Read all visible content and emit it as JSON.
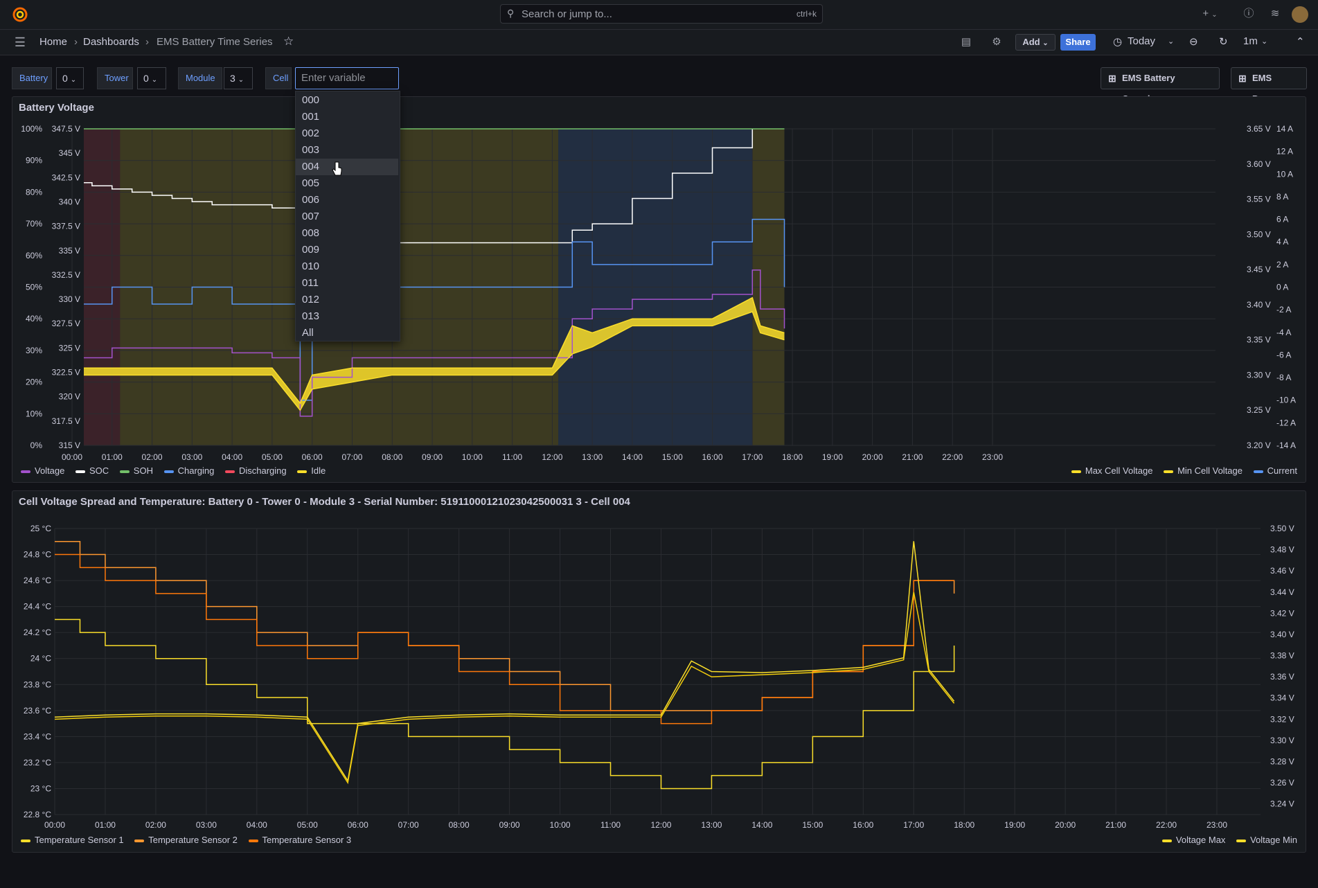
{
  "topbar": {
    "search_placeholder": "Search or jump to...",
    "search_shortcut": "ctrl+k",
    "plus_label": "+"
  },
  "breadcrumb": {
    "home": "Home",
    "dashboards": "Dashboards",
    "current": "EMS Battery Time Series"
  },
  "toolbar": {
    "add_label": "Add",
    "share_label": "Share",
    "time_range": "Today",
    "refresh_interval": "1m"
  },
  "variables": [
    {
      "label": "Battery",
      "value": "0"
    },
    {
      "label": "Tower",
      "value": "0"
    },
    {
      "label": "Module",
      "value": "3"
    },
    {
      "label": "Cell",
      "placeholder": "Enter variable value"
    }
  ],
  "dashboard_links": [
    "EMS Battery Overview",
    "EMS Power"
  ],
  "cell_dropdown": {
    "options": [
      "000",
      "001",
      "002",
      "003",
      "004",
      "005",
      "006",
      "007",
      "008",
      "009",
      "010",
      "011",
      "012",
      "013",
      "All"
    ],
    "highlighted_index": 4
  },
  "panel1": {
    "title": "Battery Voltage",
    "legend_left": [
      {
        "name": "Voltage",
        "color": "#a352cc"
      },
      {
        "name": "SOC",
        "color": "#ffffff"
      },
      {
        "name": "SOH",
        "color": "#73bf69"
      },
      {
        "name": "Charging",
        "color": "#5794f2"
      },
      {
        "name": "Discharging",
        "color": "#f2495c"
      },
      {
        "name": "Idle",
        "color": "#fade2a"
      }
    ],
    "legend_right": [
      {
        "name": "Max Cell Voltage",
        "color": "#fade2a"
      },
      {
        "name": "Min Cell Voltage",
        "color": "#fade2a"
      },
      {
        "name": "Current",
        "color": "#5794f2"
      }
    ]
  },
  "panel2": {
    "title": "Cell Voltage Spread and Temperature: Battery 0 - Tower 0 - Module 3 - Serial Number: 51911000121023042500031 3 - Cell 004",
    "legend_left": [
      {
        "name": "Temperature Sensor 1",
        "color": "#fade2a"
      },
      {
        "name": "Temperature Sensor 2",
        "color": "#ff9830"
      },
      {
        "name": "Temperature Sensor 3",
        "color": "#ff780a"
      }
    ],
    "legend_right": [
      {
        "name": "Voltage Max",
        "color": "#fade2a"
      },
      {
        "name": "Voltage Min",
        "color": "#fade2a"
      }
    ]
  },
  "chart_data": [
    {
      "type": "line",
      "title": "Battery Voltage",
      "x_ticks": [
        "00:00",
        "01:00",
        "02:00",
        "03:00",
        "04:00",
        "05:00",
        "06:00",
        "07:00",
        "08:00",
        "09:00",
        "10:00",
        "11:00",
        "12:00",
        "13:00",
        "14:00",
        "15:00",
        "16:00",
        "17:00",
        "18:00",
        "19:00",
        "20:00",
        "21:00",
        "22:00",
        "23:00"
      ],
      "y_percent_ticks": [
        "0%",
        "10%",
        "20%",
        "30%",
        "40%",
        "50%",
        "60%",
        "70%",
        "80%",
        "90%",
        "100%"
      ],
      "y_voltage_ticks": [
        "315 V",
        "317.5 V",
        "320 V",
        "322.5 V",
        "325 V",
        "327.5 V",
        "330 V",
        "332.5 V",
        "335 V",
        "337.5 V",
        "340 V",
        "342.5 V",
        "345 V",
        "347.5 V"
      ],
      "y_cell_voltage_ticks": [
        "3.20 V",
        "3.25 V",
        "3.30 V",
        "3.35 V",
        "3.40 V",
        "3.45 V",
        "3.50 V",
        "3.55 V",
        "3.60 V",
        "3.65 V"
      ],
      "y_current_ticks": [
        "-14 A",
        "-12 A",
        "-10 A",
        "-8 A",
        "-6 A",
        "-4 A",
        "-2 A",
        "0 A",
        "2 A",
        "4 A",
        "6 A",
        "8 A",
        "10 A",
        "12 A",
        "14 A"
      ],
      "states": [
        {
          "state": "Discharging",
          "from": 0.0,
          "to": 1.2
        },
        {
          "state": "Idle",
          "from": 1.2,
          "to": 12.15
        },
        {
          "state": "Charging",
          "from": 12.15,
          "to": 17.0
        },
        {
          "state": "Idle",
          "from": 17.0,
          "to": 17.8
        }
      ],
      "series": [
        {
          "name": "SOC",
          "x": [
            0,
            0.5,
            1,
            1.5,
            2,
            2.5,
            3,
            3.5,
            4,
            5,
            7,
            8,
            9,
            10,
            11,
            12,
            12.5,
            13,
            14,
            15,
            16,
            17
          ],
          "y": [
            83,
            82,
            81,
            80,
            79,
            78,
            77,
            76,
            76,
            75,
            64,
            64,
            64,
            64,
            64,
            64,
            68,
            70,
            78,
            86,
            94,
            100
          ]
        },
        {
          "name": "SOH",
          "x": [
            0,
            17.8
          ],
          "y": [
            100,
            100
          ]
        },
        {
          "name": "Current",
          "x": [
            0,
            0.5,
            1,
            2,
            3,
            4,
            5,
            5.7,
            6,
            7,
            8,
            12,
            12.5,
            13,
            14,
            15,
            16,
            17,
            17.8
          ],
          "y": [
            -1.5,
            -1.5,
            0,
            -1.5,
            0,
            -1.5,
            -1.5,
            -10,
            -4,
            0,
            0,
            0,
            4,
            2,
            2,
            2,
            4,
            6,
            0
          ]
        },
        {
          "name": "Voltage",
          "x": [
            0,
            1,
            2,
            3,
            4,
            5,
            5.7,
            6,
            7,
            8,
            12,
            12.5,
            13,
            14,
            15,
            16,
            17,
            17.2,
            17.8
          ],
          "y": [
            324,
            325,
            325,
            325,
            324.5,
            324,
            318,
            322,
            324,
            324,
            324,
            328,
            329,
            330,
            330,
            330.5,
            333,
            329,
            327
          ]
        },
        {
          "name": "Max Cell Voltage",
          "x": [
            0,
            1,
            2,
            4,
            5,
            5.7,
            6,
            7,
            8,
            10,
            12,
            12.5,
            13,
            14,
            15,
            16,
            17,
            17.2,
            17.8
          ],
          "y": [
            3.31,
            3.31,
            3.31,
            3.31,
            3.31,
            3.26,
            3.3,
            3.31,
            3.31,
            3.31,
            3.31,
            3.37,
            3.36,
            3.38,
            3.38,
            3.38,
            3.41,
            3.37,
            3.36
          ]
        },
        {
          "name": "Min Cell Voltage",
          "x": [
            0,
            1,
            2,
            4,
            5,
            5.7,
            6,
            7,
            8,
            10,
            12,
            12.5,
            13,
            14,
            15,
            16,
            17,
            17.2,
            17.8
          ],
          "y": [
            3.3,
            3.3,
            3.3,
            3.3,
            3.3,
            3.25,
            3.28,
            3.29,
            3.3,
            3.3,
            3.3,
            3.33,
            3.34,
            3.37,
            3.37,
            3.37,
            3.39,
            3.36,
            3.35
          ]
        }
      ]
    },
    {
      "type": "line",
      "title": "Cell Voltage Spread and Temperature: Battery 0 - Tower 0 - Module 3 - Serial Number: 51911000121023042500031 3 - Cell 004",
      "x_ticks": [
        "00:00",
        "01:00",
        "02:00",
        "03:00",
        "04:00",
        "05:00",
        "06:00",
        "07:00",
        "08:00",
        "09:00",
        "10:00",
        "11:00",
        "12:00",
        "13:00",
        "14:00",
        "15:00",
        "16:00",
        "17:00",
        "18:00",
        "19:00",
        "20:00",
        "21:00",
        "22:00",
        "23:00"
      ],
      "y_temp_ticks": [
        "22.8 °C",
        "23 °C",
        "23.2 °C",
        "23.4 °C",
        "23.6 °C",
        "23.8 °C",
        "24 °C",
        "24.2 °C",
        "24.4 °C",
        "24.6 °C",
        "24.8 °C",
        "25 °C"
      ],
      "y_voltage_ticks": [
        "3.24 V",
        "3.26 V",
        "3.28 V",
        "3.30 V",
        "3.32 V",
        "3.34 V",
        "3.36 V",
        "3.38 V",
        "3.40 V",
        "3.42 V",
        "3.44 V",
        "3.46 V",
        "3.48 V",
        "3.50 V"
      ],
      "series": [
        {
          "name": "Temperature Sensor 1",
          "x": [
            0,
            0.5,
            1,
            2,
            3,
            4,
            5,
            6,
            7,
            8,
            9,
            10,
            11,
            12,
            13,
            14,
            15,
            16,
            17,
            17.8
          ],
          "y": [
            24.3,
            24.2,
            24.1,
            24.0,
            23.8,
            23.7,
            23.5,
            23.5,
            23.4,
            23.4,
            23.3,
            23.2,
            23.1,
            23.0,
            23.1,
            23.2,
            23.4,
            23.6,
            23.9,
            24.1
          ]
        },
        {
          "name": "Temperature Sensor 2",
          "x": [
            0,
            0.5,
            1,
            2,
            3,
            4,
            5,
            6,
            7,
            8,
            9,
            10,
            11,
            12,
            13,
            14,
            15,
            16,
            17,
            17.8
          ],
          "y": [
            24.9,
            24.8,
            24.7,
            24.6,
            24.4,
            24.2,
            24.1,
            24.2,
            24.1,
            24.0,
            23.9,
            23.8,
            23.6,
            23.6,
            23.6,
            23.7,
            23.9,
            24.1,
            24.6,
            24.5
          ]
        },
        {
          "name": "Temperature Sensor 3",
          "x": [
            0,
            0.5,
            1,
            2,
            3,
            4,
            5,
            6,
            7,
            8,
            9,
            10,
            11,
            12,
            13,
            14,
            15,
            16,
            17,
            17.8
          ],
          "y": [
            24.8,
            24.7,
            24.6,
            24.5,
            24.3,
            24.1,
            24.0,
            24.2,
            24.1,
            23.9,
            23.8,
            23.6,
            23.6,
            23.5,
            23.6,
            23.7,
            23.9,
            24.1,
            24.6,
            24.6
          ]
        },
        {
          "name": "Voltage Max",
          "x": [
            0,
            1,
            2,
            3,
            4,
            5,
            5.8,
            6,
            7,
            8,
            9,
            10,
            11,
            12,
            12.6,
            13,
            14,
            15,
            16,
            16.8,
            17,
            17.3,
            17.8
          ],
          "y": [
            3.322,
            3.324,
            3.325,
            3.325,
            3.324,
            3.322,
            3.262,
            3.316,
            3.322,
            3.324,
            3.325,
            3.324,
            3.324,
            3.324,
            3.375,
            3.365,
            3.364,
            3.366,
            3.369,
            3.378,
            3.488,
            3.367,
            3.337
          ]
        },
        {
          "name": "Voltage Min",
          "x": [
            0,
            1,
            2,
            3,
            4,
            5,
            5.8,
            6,
            7,
            8,
            9,
            10,
            11,
            12,
            12.6,
            13,
            14,
            15,
            16,
            16.8,
            17,
            17.3,
            17.8
          ],
          "y": [
            3.32,
            3.322,
            3.323,
            3.323,
            3.322,
            3.32,
            3.26,
            3.314,
            3.32,
            3.322,
            3.323,
            3.322,
            3.322,
            3.322,
            3.37,
            3.36,
            3.362,
            3.364,
            3.367,
            3.376,
            3.44,
            3.365,
            3.335
          ]
        }
      ]
    }
  ]
}
